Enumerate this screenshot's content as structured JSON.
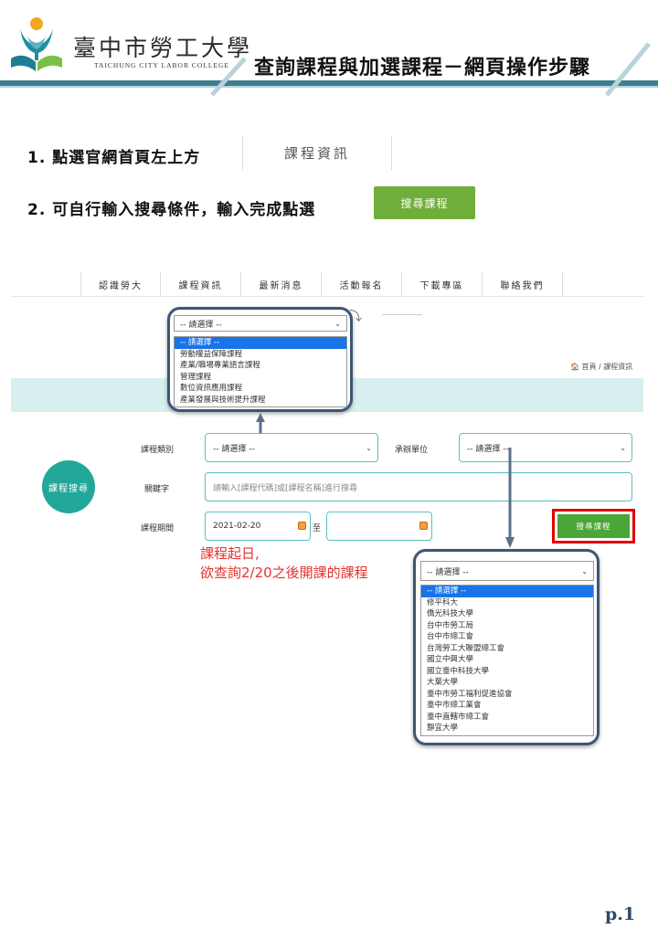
{
  "header": {
    "brand_zh": "臺中市勞工大學",
    "brand_en": "TAICHUNG CITY LABOR COLLEGE",
    "title": "查詢課程與加選課程－網頁操作步驟"
  },
  "steps": [
    {
      "text": "1. 點選官網首頁左上方"
    },
    {
      "text": "2. 可自行輸入搜尋條件，輸入完成點選"
    }
  ],
  "step1_tab_label": "課程資訊",
  "step2_button_label": "搜尋課程",
  "nav": [
    "認識勞大",
    "課程資訊",
    "最新消息",
    "活動報名",
    "下載專區",
    "聯絡我們"
  ],
  "breadcrumb": "🏠 首頁 / 課程資訊",
  "category_dropdown": {
    "selected": "-- 請選擇 --",
    "options": [
      "-- 請選擇 --",
      "勞動權益保障課程",
      "產業/職場專業語言課程",
      "管理課程",
      "數位資訊應用課程",
      "產業發展與技術提升課程"
    ]
  },
  "search_form": {
    "circle_label": "課程搜尋",
    "category_label": "課程類別",
    "category_value": "-- 請選擇 --",
    "organizer_label": "承辦單位",
    "organizer_value": "-- 請選擇 --",
    "keyword_label": "關鍵字",
    "keyword_placeholder": "請輸入[課程代碼]或[課程名稱]進行搜尋",
    "period_label": "課程期間",
    "date_from": "2021-02-20",
    "date_sep": "至",
    "date_to": "",
    "search_button": "搜尋課程"
  },
  "note": {
    "line1": "課程起日,",
    "line2": "欲查詢2/20之後開課的課程"
  },
  "organizer_dropdown": {
    "selected": "-- 請選擇 --",
    "options": [
      "-- 請選擇 --",
      "修平科大",
      "僑光科技大學",
      "台中市勞工局",
      "台中市總工會",
      "台灣勞工大聯盟總工會",
      "國立中興大學",
      "國立臺中科技大學",
      "大葉大學",
      "臺中市勞工福利促進協會",
      "臺中市總工業會",
      "臺中直轄市總工會",
      "靜宜大學"
    ]
  },
  "page_number": "p.1",
  "colors": {
    "header_band": "#3c7f92",
    "callout_border": "#3d5677",
    "button_green": "#6fae3a",
    "circle_teal": "#22a89a",
    "note_red": "#e3332d",
    "highlight_red": "#e00000"
  }
}
